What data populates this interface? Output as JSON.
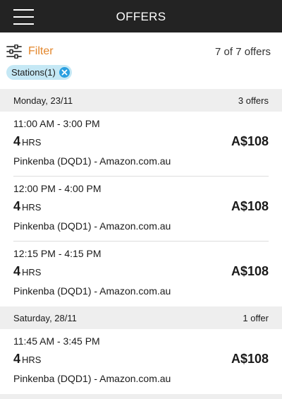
{
  "header": {
    "title": "OFFERS",
    "menu_icon": "hamburger-menu-icon"
  },
  "filter": {
    "label": "Filter",
    "icon": "sliders-icon",
    "count_text": "7 of 7 offers",
    "accent_color": "#e3862b"
  },
  "chip": {
    "label": "Stations(1)",
    "close_icon": "close-circle-icon"
  },
  "days": [
    {
      "date": "Monday, 23/11",
      "count": "3 offers",
      "offers": [
        {
          "time": "11:00 AM - 3:00 PM",
          "hours": "4",
          "unit": "HRS",
          "price": "A$108",
          "station": "Pinkenba (DQD1) - Amazon.com.au"
        },
        {
          "time": "12:00 PM - 4:00 PM",
          "hours": "4",
          "unit": "HRS",
          "price": "A$108",
          "station": "Pinkenba (DQD1) - Amazon.com.au"
        },
        {
          "time": "12:15 PM - 4:15 PM",
          "hours": "4",
          "unit": "HRS",
          "price": "A$108",
          "station": "Pinkenba (DQD1) - Amazon.com.au"
        }
      ]
    },
    {
      "date": "Saturday, 28/11",
      "count": "1 offer",
      "offers": [
        {
          "time": "11:45 AM - 3:45 PM",
          "hours": "4",
          "unit": "HRS",
          "price": "A$108",
          "station": "Pinkenba (DQD1) - Amazon.com.au"
        }
      ]
    }
  ]
}
